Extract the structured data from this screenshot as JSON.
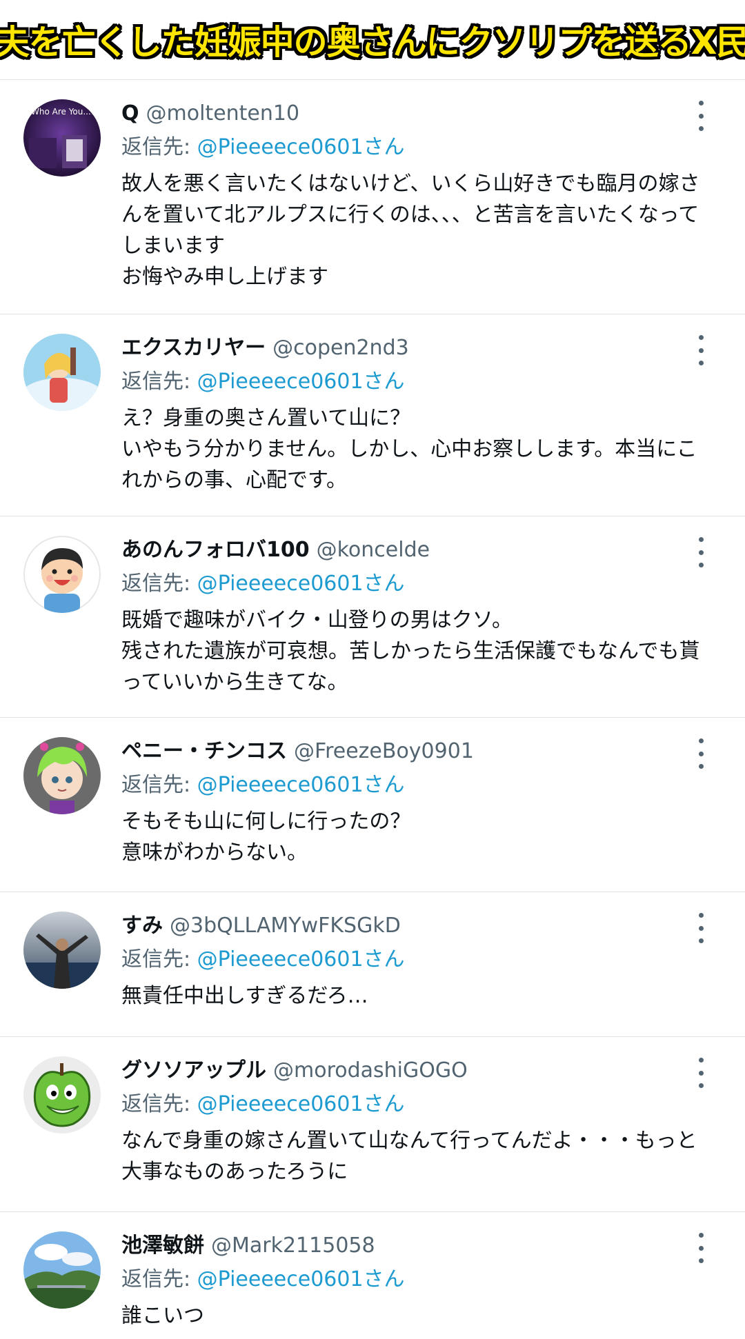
{
  "headline": "夫を亡くした妊娠中の奥さんにクソリプを送るX民",
  "reply_prefix": "返信先:",
  "tweets": [
    {
      "name": "Q",
      "handle": "@moltenten10",
      "reply_to": "@Pieeeece0601さん",
      "text": "故人を悪く言いたくはないけど、いくら山好きでも臨月の嫁さんを置いて北アルプスに行くのは、、、と苦言を言いたくなってしまいます\nお悔やみ申し上げます",
      "avatar_icon": "who-are-you-avatar-icon",
      "avatar_text": "Who Are You...!?"
    },
    {
      "name": "エクスカリヤー",
      "handle": "@copen2nd3",
      "reply_to": "@Pieeeece0601さん",
      "text": "え？身重の奥さん置いて山に？\nいやもう分かりません。しかし、心中お察しします。本当にこれからの事、心配です。",
      "avatar_icon": "anime-character-avatar-icon"
    },
    {
      "name": "あのんフォロバ100",
      "handle": "@koncelde",
      "reply_to": "@Pieeeece0601さん",
      "text": "既婚で趣味がバイク・山登りの男はクソ。\n残された遺族が可哀想。苦しかったら生活保護でもなんでも貰っていいから生きてな。",
      "avatar_icon": "cartoon-boy-avatar-icon"
    },
    {
      "name": "ペニー・チンコス",
      "handle": "@FreezeBoy0901",
      "reply_to": "@Pieeeece0601さん",
      "text": "そもそも山に何しに行ったの？\n意味がわからない。",
      "avatar_icon": "green-hair-character-avatar-icon"
    },
    {
      "name": "すみ",
      "handle": "@3bQLLAMYwFKSGkD",
      "reply_to": "@Pieeeece0601さん",
      "text": "無責任中出しすぎるだろ…",
      "avatar_icon": "person-photo-avatar-icon"
    },
    {
      "name": "グソソアップル",
      "handle": "@morodashiGOGO",
      "reply_to": "@Pieeeece0601さん",
      "text": "なんで身重の嫁さん置いて山なんて行ってんだよ・・・もっと大事なものあったろうに",
      "avatar_icon": "green-apple-avatar-icon"
    },
    {
      "name": "池澤敏餅",
      "handle": "@Mark2115058",
      "reply_to": "@Pieeeece0601さん",
      "text": "誰こいつ",
      "avatar_icon": "landscape-photo-avatar-icon"
    }
  ],
  "colors": {
    "headline_fill": "#ffe600",
    "headline_outline": "#000000",
    "reply_link": "#1d9bd1",
    "secondary_text": "#536471",
    "divider": "#dfe3e6"
  }
}
